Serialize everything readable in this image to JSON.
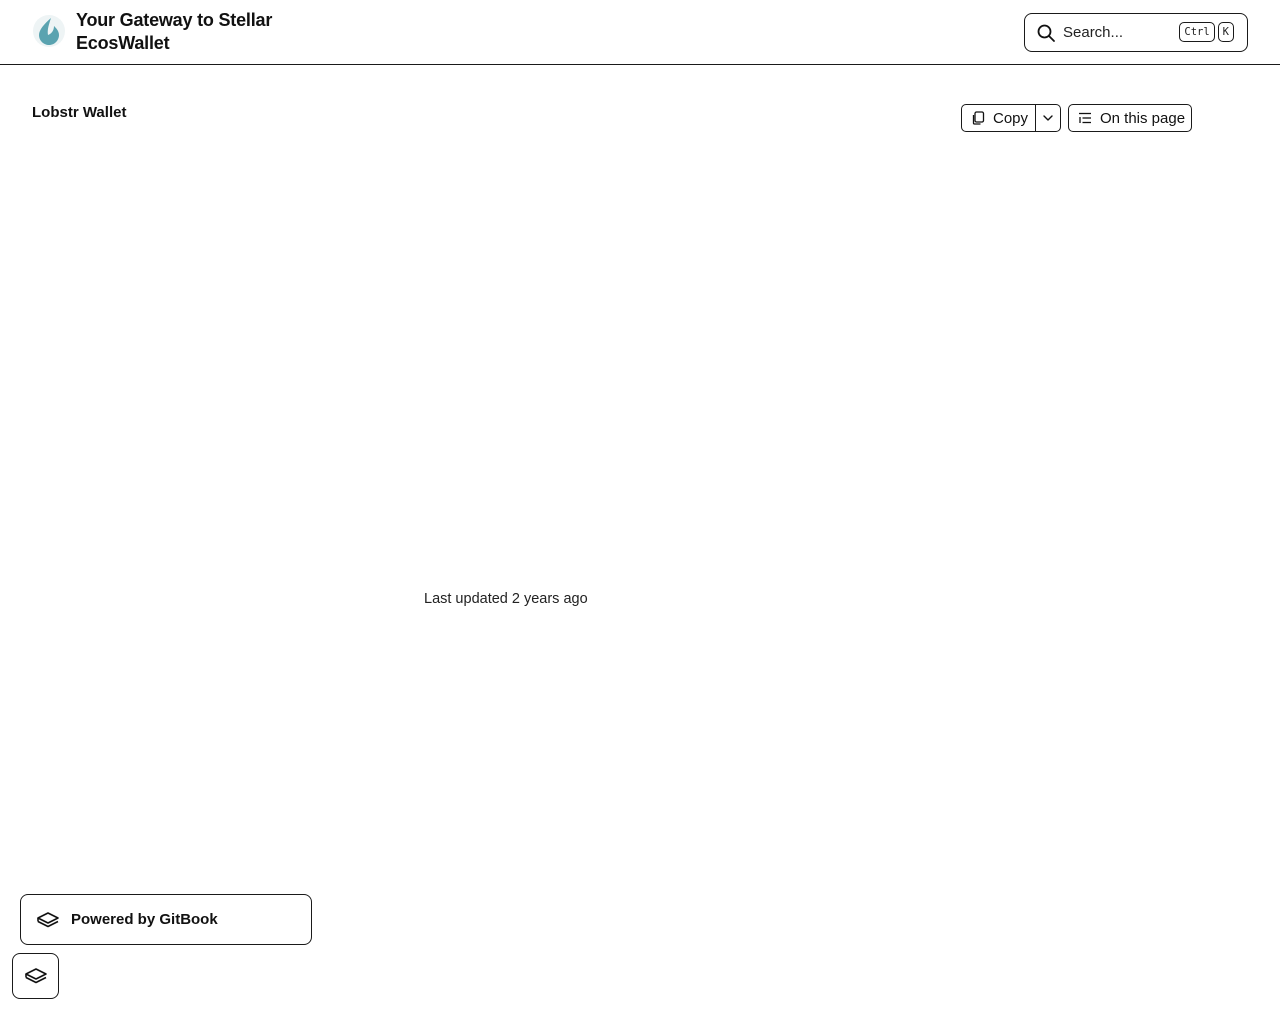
{
  "header": {
    "title_line1": "Your Gateway to Stellar",
    "title_line2": "EcosWallet",
    "logo_icon": "droplet-logo-icon",
    "logo_color": "#5aa3b0"
  },
  "search": {
    "placeholder": "Search...",
    "shortcut_keys": [
      "Ctrl",
      "K"
    ],
    "icon": "search-icon"
  },
  "page": {
    "title": "Lobstr Wallet",
    "last_updated": "Last updated 2 years ago"
  },
  "toolbar": {
    "copy_label": "Copy",
    "copy_icon": "copy-icon",
    "dropdown_icon": "chevron-down-icon",
    "toc_label": "On this page",
    "toc_icon": "list-icon"
  },
  "footer": {
    "powered_label": "Powered by GitBook",
    "gitbook_icon": "gitbook-icon"
  }
}
